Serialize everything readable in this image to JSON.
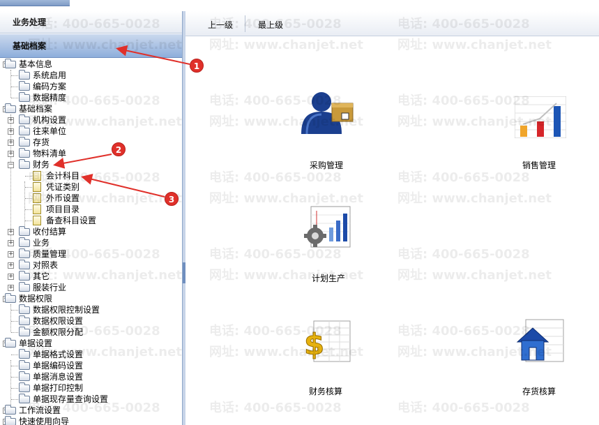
{
  "nav": {
    "business": "业务处理",
    "basic_archives": "基础档案"
  },
  "toolbar": {
    "up": "上一级",
    "top": "最上级"
  },
  "tree": [
    {
      "label": "基本信息"
    },
    {
      "label": "系统启用"
    },
    {
      "label": "编码方案"
    },
    {
      "label": "数据精度"
    },
    {
      "label": "基础档案"
    },
    {
      "label": "机构设置"
    },
    {
      "label": "往来单位"
    },
    {
      "label": "存货"
    },
    {
      "label": "物料清单"
    },
    {
      "label": "财务"
    },
    {
      "label": "会计科目"
    },
    {
      "label": "凭证类别"
    },
    {
      "label": "外币设置"
    },
    {
      "label": "项目目录"
    },
    {
      "label": "备查科目设置"
    },
    {
      "label": "收付结算"
    },
    {
      "label": "业务"
    },
    {
      "label": "质量管理"
    },
    {
      "label": "对照表"
    },
    {
      "label": "其它"
    },
    {
      "label": "服装行业"
    },
    {
      "label": "数据权限"
    },
    {
      "label": "数据权限控制设置"
    },
    {
      "label": "数据权限设置"
    },
    {
      "label": "金额权限分配"
    },
    {
      "label": "单据设置"
    },
    {
      "label": "单据格式设置"
    },
    {
      "label": "单据编码设置"
    },
    {
      "label": "单据消息设置"
    },
    {
      "label": "单据打印控制"
    },
    {
      "label": "单据现存量查询设置"
    },
    {
      "label": "工作流设置"
    },
    {
      "label": "快速使用向导"
    }
  ],
  "modules": [
    {
      "label": "采购管理",
      "icon": "purchase-icon"
    },
    {
      "label": "销售管理",
      "icon": "sales-chart-icon"
    },
    {
      "label": "计划生产",
      "icon": "production-gear-icon"
    },
    {
      "label": "财务核算",
      "icon": "dollar-icon"
    },
    {
      "label": "存货核算",
      "icon": "house-icon"
    }
  ],
  "watermark": {
    "phone": "电话: 400-665-0028",
    "site": "网址: www.chanjet.net"
  },
  "annotations": [
    "1",
    "2",
    "3"
  ],
  "colors": {
    "annotation": "#e0302a",
    "nav_active": "#8eaedb"
  }
}
